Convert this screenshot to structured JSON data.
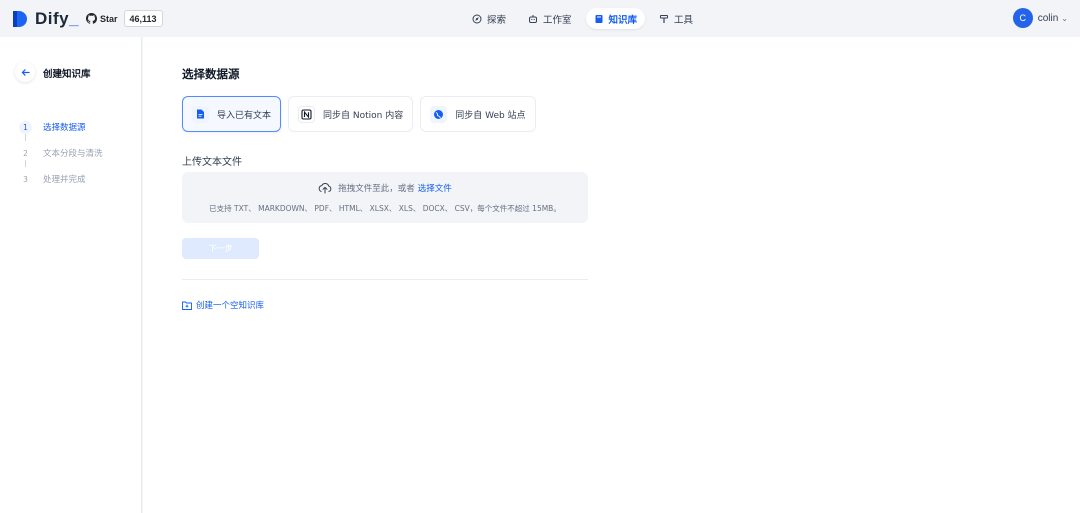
{
  "header": {
    "logo_text": "Dify",
    "github": {
      "star_label": "Star",
      "star_count": "46,113"
    },
    "nav": [
      {
        "label": "探索",
        "icon": "compass-icon"
      },
      {
        "label": "工作室",
        "icon": "robot-icon"
      },
      {
        "label": "知识库",
        "icon": "book-icon",
        "active": true
      },
      {
        "label": "工具",
        "icon": "hammer-icon"
      }
    ],
    "user": {
      "initial": "C",
      "name": "colin"
    }
  },
  "sidebar": {
    "title": "创建知识库",
    "steps": [
      {
        "num": "1",
        "label": "选择数据源",
        "active": true
      },
      {
        "num": "2",
        "label": "文本分段与清洗"
      },
      {
        "num": "3",
        "label": "处理并完成"
      }
    ]
  },
  "main": {
    "title": "选择数据源",
    "sources": [
      {
        "label": "导入已有文本",
        "icon": "file-icon",
        "active": true
      },
      {
        "label": "同步自 Notion 内容",
        "icon": "notion-icon"
      },
      {
        "label": "同步自 Web 站点",
        "icon": "globe-icon"
      }
    ],
    "upload": {
      "label": "上传文本文件",
      "drag_text": "拖拽文件至此，或者",
      "select_link": "选择文件",
      "supported": "已支持 TXT、 MARKDOWN、 PDF、 HTML、 XLSX、 XLS、 DOCX、 CSV，每个文件不超过 15MB。"
    },
    "next_button": "下一步",
    "create_empty": "创建一个空知识库"
  },
  "colors": {
    "primary": "#155eef",
    "background": "#f2f4f7",
    "avatar": "#2563eb"
  }
}
